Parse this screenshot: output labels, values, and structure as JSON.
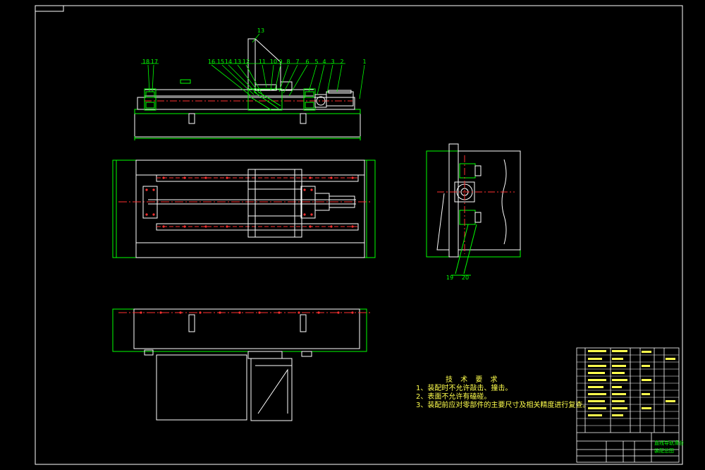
{
  "drawing": {
    "balloons_top": [
      "18",
      "17",
      "16",
      "15",
      "14",
      "13",
      "12",
      "11",
      "10",
      "9",
      "8",
      "7",
      "6",
      "5",
      "4",
      "3",
      "2",
      "1"
    ],
    "balloon_top_center": "13",
    "balloons_side": [
      "19",
      "20"
    ],
    "tech_requirements": {
      "title": "技 术 要 求",
      "items": [
        "1、装配时不允许敲击、撞击。",
        "2、表面不允许有磕碰。",
        "3、装配前应对零部件的主要尺寸及相关精度进行复查。"
      ]
    },
    "title_block": {
      "drawing_name_1": "直线导轨滑台",
      "drawing_name_2": "装配总图"
    },
    "colors": {
      "background": "#000000",
      "frame": "#ffffff",
      "outline": "#ffffff",
      "part_lines": "#00ff00",
      "center_lines": "#ff3030",
      "text": "#ffff4d",
      "dims": "#00ffff"
    }
  }
}
